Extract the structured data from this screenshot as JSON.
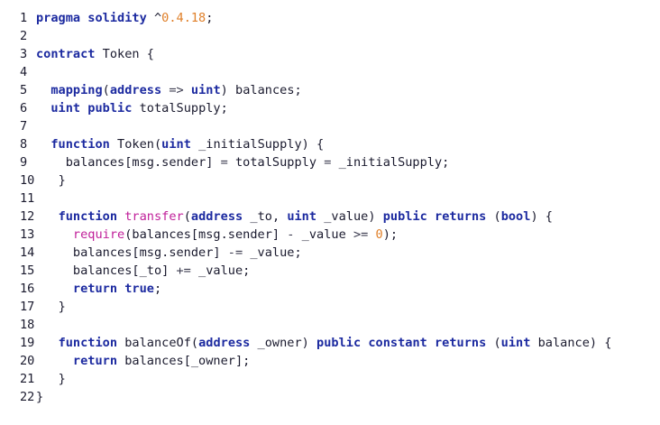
{
  "colors": {
    "keyword": "#1c2aa0",
    "function_call": "#c0209a",
    "number": "#e0802a",
    "text": "#1a1a2e",
    "background": "#ffffff"
  },
  "lines": [
    {
      "n": "1",
      "indent": "",
      "tokens": [
        {
          "t": "kw",
          "v": "pragma solidity"
        },
        {
          "t": "id",
          "v": " ^"
        },
        {
          "t": "num",
          "v": "0.4.18"
        },
        {
          "t": "id",
          "v": ";"
        }
      ]
    },
    {
      "n": "2",
      "indent": "",
      "tokens": []
    },
    {
      "n": "3",
      "indent": "",
      "tokens": [
        {
          "t": "kw",
          "v": "contract"
        },
        {
          "t": "id",
          "v": " Token {"
        }
      ]
    },
    {
      "n": "4",
      "indent": "",
      "tokens": []
    },
    {
      "n": "5",
      "indent": "  ",
      "tokens": [
        {
          "t": "kw",
          "v": "mapping"
        },
        {
          "t": "id",
          "v": "("
        },
        {
          "t": "kw",
          "v": "address"
        },
        {
          "t": "op",
          "v": " => "
        },
        {
          "t": "kw",
          "v": "uint"
        },
        {
          "t": "id",
          "v": ") balances;"
        }
      ]
    },
    {
      "n": "6",
      "indent": "  ",
      "tokens": [
        {
          "t": "kw",
          "v": "uint public"
        },
        {
          "t": "id",
          "v": " totalSupply;"
        }
      ]
    },
    {
      "n": "7",
      "indent": "",
      "tokens": []
    },
    {
      "n": "8",
      "indent": "  ",
      "tokens": [
        {
          "t": "kw",
          "v": "function"
        },
        {
          "t": "id",
          "v": " Token("
        },
        {
          "t": "kw",
          "v": "uint"
        },
        {
          "t": "id",
          "v": " _initialSupply) {"
        }
      ]
    },
    {
      "n": "9",
      "indent": "    ",
      "tokens": [
        {
          "t": "id",
          "v": "balances[msg.sender] "
        },
        {
          "t": "op",
          "v": "="
        },
        {
          "t": "id",
          "v": " totalSupply "
        },
        {
          "t": "op",
          "v": "="
        },
        {
          "t": "id",
          "v": " _initialSupply;"
        }
      ]
    },
    {
      "n": "10",
      "indent": "   ",
      "tokens": [
        {
          "t": "id",
          "v": "}"
        }
      ]
    },
    {
      "n": "11",
      "indent": "",
      "tokens": []
    },
    {
      "n": "12",
      "indent": "   ",
      "tokens": [
        {
          "t": "kw",
          "v": "function"
        },
        {
          "t": "id",
          "v": " "
        },
        {
          "t": "fn",
          "v": "transfer"
        },
        {
          "t": "id",
          "v": "("
        },
        {
          "t": "kw",
          "v": "address"
        },
        {
          "t": "id",
          "v": " _to, "
        },
        {
          "t": "kw",
          "v": "uint"
        },
        {
          "t": "id",
          "v": " _value) "
        },
        {
          "t": "kw",
          "v": "public returns"
        },
        {
          "t": "id",
          "v": " ("
        },
        {
          "t": "kw",
          "v": "bool"
        },
        {
          "t": "id",
          "v": ") {"
        }
      ]
    },
    {
      "n": "13",
      "indent": "     ",
      "tokens": [
        {
          "t": "fn",
          "v": "require"
        },
        {
          "t": "id",
          "v": "(balances[msg.sender] "
        },
        {
          "t": "op",
          "v": "-"
        },
        {
          "t": "id",
          "v": " _value "
        },
        {
          "t": "op",
          "v": ">="
        },
        {
          "t": "id",
          "v": " "
        },
        {
          "t": "num",
          "v": "0"
        },
        {
          "t": "id",
          "v": ");"
        }
      ]
    },
    {
      "n": "14",
      "indent": "     ",
      "tokens": [
        {
          "t": "id",
          "v": "balances[msg.sender] "
        },
        {
          "t": "op",
          "v": "-="
        },
        {
          "t": "id",
          "v": " _value;"
        }
      ]
    },
    {
      "n": "15",
      "indent": "     ",
      "tokens": [
        {
          "t": "id",
          "v": "balances[_to] "
        },
        {
          "t": "op",
          "v": "+="
        },
        {
          "t": "id",
          "v": " _value;"
        }
      ]
    },
    {
      "n": "16",
      "indent": "     ",
      "tokens": [
        {
          "t": "kw",
          "v": "return true"
        },
        {
          "t": "id",
          "v": ";"
        }
      ]
    },
    {
      "n": "17",
      "indent": "   ",
      "tokens": [
        {
          "t": "id",
          "v": "}"
        }
      ]
    },
    {
      "n": "18",
      "indent": "",
      "tokens": []
    },
    {
      "n": "19",
      "indent": "   ",
      "tokens": [
        {
          "t": "kw",
          "v": "function"
        },
        {
          "t": "id",
          "v": " balanceOf("
        },
        {
          "t": "kw",
          "v": "address"
        },
        {
          "t": "id",
          "v": " _owner) "
        },
        {
          "t": "kw",
          "v": "public constant returns"
        },
        {
          "t": "id",
          "v": " ("
        },
        {
          "t": "kw",
          "v": "uint"
        },
        {
          "t": "id",
          "v": " balance) {"
        }
      ]
    },
    {
      "n": "20",
      "indent": "     ",
      "tokens": [
        {
          "t": "kw",
          "v": "return"
        },
        {
          "t": "id",
          "v": " balances[_owner];"
        }
      ]
    },
    {
      "n": "21",
      "indent": "   ",
      "tokens": [
        {
          "t": "id",
          "v": "}"
        }
      ]
    },
    {
      "n": "22",
      "indent": "",
      "tokens": [
        {
          "t": "id",
          "v": "}"
        }
      ]
    }
  ]
}
